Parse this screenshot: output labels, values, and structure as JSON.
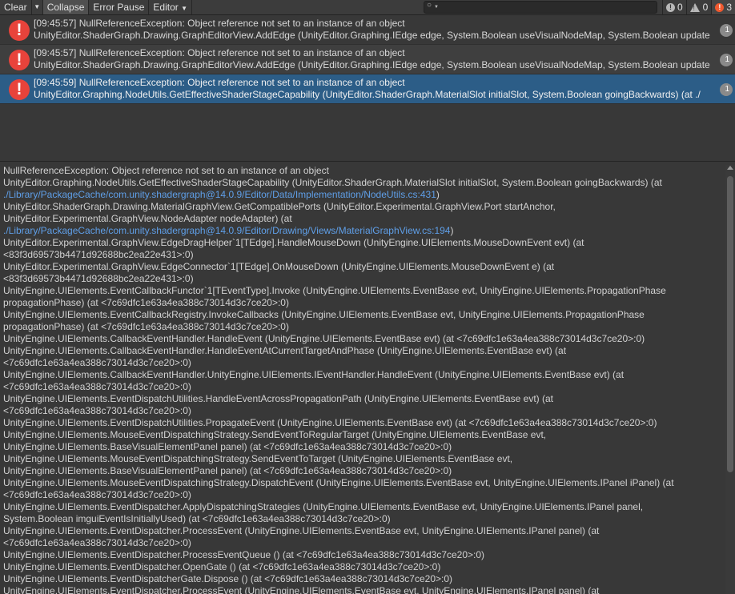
{
  "toolbar": {
    "clear": "Clear",
    "collapse": "Collapse",
    "error_pause": "Error Pause",
    "editor": "Editor",
    "search_value": "",
    "info_count": "0",
    "warning_count": "0",
    "error_count": "3"
  },
  "entries": [
    {
      "line1": "[09:45:57] NullReferenceException: Object reference not set to an instance of an object",
      "line2": "UnityEditor.ShaderGraph.Drawing.GraphEditorView.AddEdge (UnityEditor.Graphing.IEdge edge, System.Boolean useVisualNodeMap, System.Boolean update",
      "count": "1"
    },
    {
      "line1": "[09:45:57] NullReferenceException: Object reference not set to an instance of an object",
      "line2": "UnityEditor.ShaderGraph.Drawing.GraphEditorView.AddEdge (UnityEditor.Graphing.IEdge edge, System.Boolean useVisualNodeMap, System.Boolean update",
      "count": "1"
    },
    {
      "line1": "[09:45:59] NullReferenceException: Object reference not set to an instance of an object",
      "line2": "UnityEditor.Graphing.NodeUtils.GetEffectiveShaderStageCapability (UnityEditor.ShaderGraph.MaterialSlot initialSlot, System.Boolean goingBackwards) (at ./",
      "count": "1"
    }
  ],
  "detail": {
    "l01": "NullReferenceException: Object reference not set to an instance of an object",
    "l02": "UnityEditor.Graphing.NodeUtils.GetEffectiveShaderStageCapability (UnityEditor.ShaderGraph.MaterialSlot initialSlot, System.Boolean goingBackwards) (at",
    "l03_link": "./Library/PackageCache/com.unity.shadergraph@14.0.9/Editor/Data/Implementation/NodeUtils.cs:431",
    "l03_tail": ")",
    "l04": "UnityEditor.ShaderGraph.Drawing.MaterialGraphView.GetCompatiblePorts (UnityEditor.Experimental.GraphView.Port startAnchor,",
    "l05": "UnityEditor.Experimental.GraphView.NodeAdapter nodeAdapter) (at",
    "l06_link": "./Library/PackageCache/com.unity.shadergraph@14.0.9/Editor/Drawing/Views/MaterialGraphView.cs:194",
    "l06_tail": ")",
    "l07": "UnityEditor.Experimental.GraphView.EdgeDragHelper`1[TEdge].HandleMouseDown (UnityEngine.UIElements.MouseDownEvent evt) (at",
    "l08": "<83f3d69573b4471d92688bc2ea22e431>:0)",
    "l09": "UnityEditor.Experimental.GraphView.EdgeConnector`1[TEdge].OnMouseDown (UnityEngine.UIElements.MouseDownEvent e) (at",
    "l10": "<83f3d69573b4471d92688bc2ea22e431>:0)",
    "l11": "UnityEngine.UIElements.EventCallbackFunctor`1[TEventType].Invoke (UnityEngine.UIElements.EventBase evt, UnityEngine.UIElements.PropagationPhase",
    "l12": "propagationPhase) (at <7c69dfc1e63a4ea388c73014d3c7ce20>:0)",
    "l13": "UnityEngine.UIElements.EventCallbackRegistry.InvokeCallbacks (UnityEngine.UIElements.EventBase evt, UnityEngine.UIElements.PropagationPhase",
    "l14": "propagationPhase) (at <7c69dfc1e63a4ea388c73014d3c7ce20>:0)",
    "l15": "UnityEngine.UIElements.CallbackEventHandler.HandleEvent (UnityEngine.UIElements.EventBase evt) (at <7c69dfc1e63a4ea388c73014d3c7ce20>:0)",
    "l16": "UnityEngine.UIElements.CallbackEventHandler.HandleEventAtCurrentTargetAndPhase (UnityEngine.UIElements.EventBase evt) (at",
    "l17": "<7c69dfc1e63a4ea388c73014d3c7ce20>:0)",
    "l18": "UnityEngine.UIElements.CallbackEventHandler.UnityEngine.UIElements.IEventHandler.HandleEvent (UnityEngine.UIElements.EventBase evt) (at",
    "l19": "<7c69dfc1e63a4ea388c73014d3c7ce20>:0)",
    "l20": "UnityEngine.UIElements.EventDispatchUtilities.HandleEventAcrossPropagationPath (UnityEngine.UIElements.EventBase evt) (at",
    "l21": "<7c69dfc1e63a4ea388c73014d3c7ce20>:0)",
    "l22": "UnityEngine.UIElements.EventDispatchUtilities.PropagateEvent (UnityEngine.UIElements.EventBase evt) (at <7c69dfc1e63a4ea388c73014d3c7ce20>:0)",
    "l23": "UnityEngine.UIElements.MouseEventDispatchingStrategy.SendEventToRegularTarget (UnityEngine.UIElements.EventBase evt,",
    "l24": "UnityEngine.UIElements.BaseVisualElementPanel panel) (at <7c69dfc1e63a4ea388c73014d3c7ce20>:0)",
    "l25": "UnityEngine.UIElements.MouseEventDispatchingStrategy.SendEventToTarget (UnityEngine.UIElements.EventBase evt,",
    "l26": "UnityEngine.UIElements.BaseVisualElementPanel panel) (at <7c69dfc1e63a4ea388c73014d3c7ce20>:0)",
    "l27": "UnityEngine.UIElements.MouseEventDispatchingStrategy.DispatchEvent (UnityEngine.UIElements.EventBase evt, UnityEngine.UIElements.IPanel iPanel) (at",
    "l28": "<7c69dfc1e63a4ea388c73014d3c7ce20>:0)",
    "l29": "UnityEngine.UIElements.EventDispatcher.ApplyDispatchingStrategies (UnityEngine.UIElements.EventBase evt, UnityEngine.UIElements.IPanel panel,",
    "l30": "System.Boolean imguiEventIsInitiallyUsed) (at <7c69dfc1e63a4ea388c73014d3c7ce20>:0)",
    "l31": "UnityEngine.UIElements.EventDispatcher.ProcessEvent (UnityEngine.UIElements.EventBase evt, UnityEngine.UIElements.IPanel panel) (at",
    "l32": "<7c69dfc1e63a4ea388c73014d3c7ce20>:0)",
    "l33": "UnityEngine.UIElements.EventDispatcher.ProcessEventQueue () (at <7c69dfc1e63a4ea388c73014d3c7ce20>:0)",
    "l34": "UnityEngine.UIElements.EventDispatcher.OpenGate () (at <7c69dfc1e63a4ea388c73014d3c7ce20>:0)",
    "l35": "UnityEngine.UIElements.EventDispatcherGate.Dispose () (at <7c69dfc1e63a4ea388c73014d3c7ce20>:0)",
    "l36": "UnityEngine.UIElements.EventDispatcher.ProcessEvent (UnityEngine.UIElements.EventBase evt, UnityEngine.UIElements.IPanel panel) (at"
  }
}
